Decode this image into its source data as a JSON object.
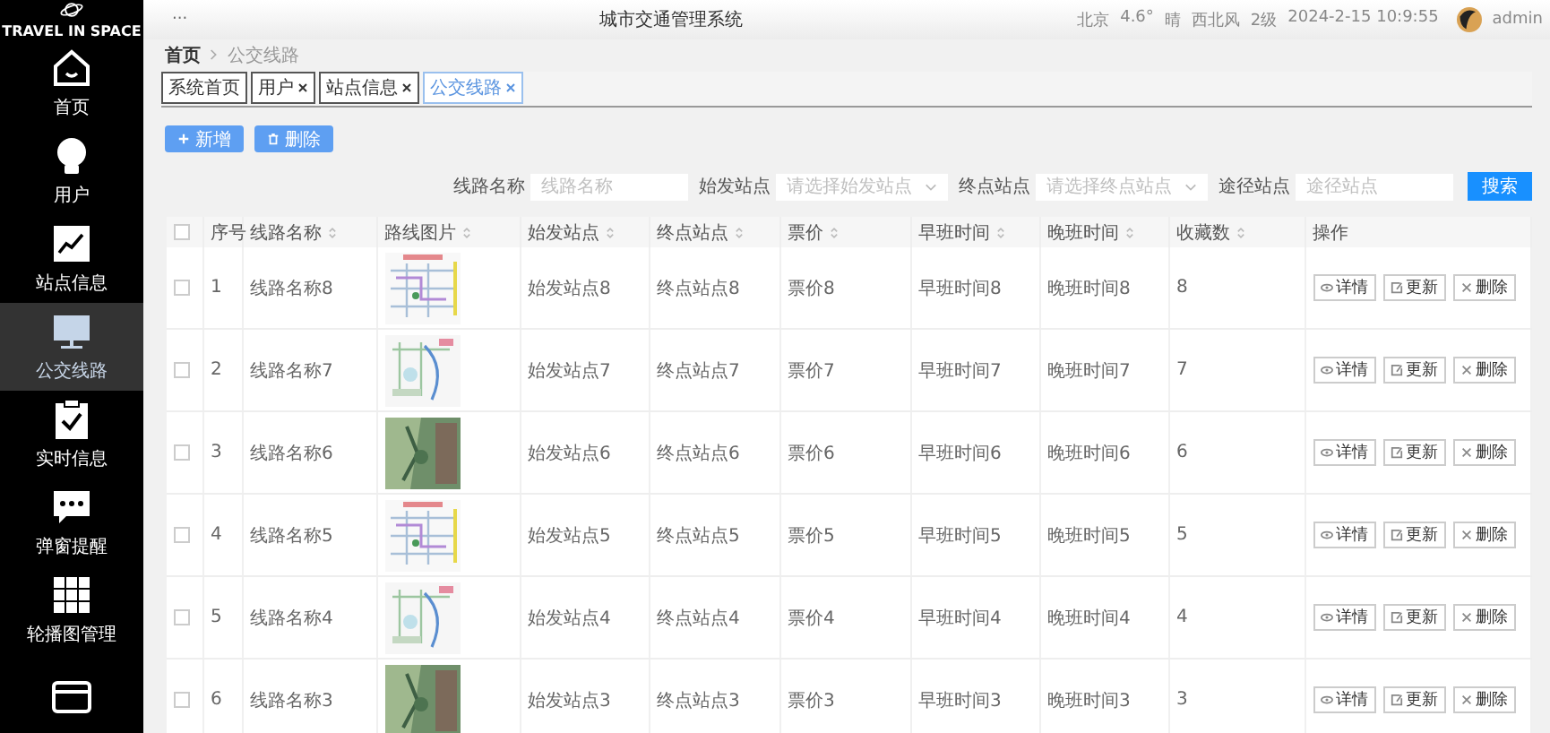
{
  "sidebar": {
    "logo": "TRAVEL IN SPACE",
    "items": [
      {
        "kind": "home",
        "label": "首页",
        "selected": false
      },
      {
        "kind": "bulb",
        "label": "用户",
        "selected": false
      },
      {
        "kind": "chart",
        "label": "站点信息",
        "selected": false
      },
      {
        "kind": "monitor",
        "label": "公交线路",
        "selected": true
      },
      {
        "kind": "clipboard",
        "label": "实时信息",
        "selected": false
      },
      {
        "kind": "chat",
        "label": "弹窗提醒",
        "selected": false
      },
      {
        "kind": "grid",
        "label": "轮播图管理",
        "selected": false
      },
      {
        "kind": "card",
        "selected": false
      }
    ]
  },
  "header": {
    "menu": "···",
    "title": "城市交通管理系统",
    "weather": [
      "北京",
      "4.6°",
      "晴",
      "西北风",
      "2级",
      "2024-2-15 10:9:55"
    ],
    "user": "admin"
  },
  "breadcrumb": [
    "首页",
    "公交线路"
  ],
  "tabs": [
    {
      "label": "系统首页",
      "closable": false,
      "selected": false
    },
    {
      "label": "用户",
      "closable": true,
      "selected": false
    },
    {
      "label": "站点信息",
      "closable": true,
      "selected": false
    },
    {
      "label": "公交线路",
      "closable": true,
      "selected": true
    }
  ],
  "actions": [
    {
      "kind": "add",
      "label": "新增"
    },
    {
      "kind": "delete",
      "label": "删除"
    }
  ],
  "search": {
    "fields": [
      {
        "label": "线路名称",
        "placeholder": "线路名称",
        "kind": "input"
      },
      {
        "label": "始发站点",
        "placeholder": "请选择始发站点",
        "kind": "select"
      },
      {
        "label": "终点站点",
        "placeholder": "请选择终点站点",
        "kind": "select"
      },
      {
        "label": "途径站点",
        "placeholder": "途径站点",
        "kind": "input"
      }
    ],
    "button": "搜索"
  },
  "table": {
    "select_all": {
      "checked": false
    },
    "columns": [
      {
        "label": "序号",
        "sortable": false
      },
      {
        "label": "线路名称",
        "sortable": true
      },
      {
        "label": "路线图片",
        "sortable": true
      },
      {
        "label": "始发站点",
        "sortable": true
      },
      {
        "label": "终点站点",
        "sortable": true
      },
      {
        "label": "票价",
        "sortable": true
      },
      {
        "label": "早班时间",
        "sortable": true
      },
      {
        "label": "晚班时间",
        "sortable": true
      },
      {
        "label": "收藏数",
        "sortable": true
      },
      {
        "label": "操作",
        "sortable": false
      }
    ],
    "rows": [
      {
        "checked": false,
        "index": "1",
        "name": "线路名称8",
        "start": "始发站点8",
        "end": "终点站点8",
        "fare": "票价8",
        "first": "早班时间8",
        "last": "晚班时间8",
        "favorites": "8",
        "actions": [
          {
            "kind": "view",
            "label": "详情"
          },
          {
            "kind": "edit",
            "label": "更新"
          },
          {
            "kind": "delete",
            "label": "删除"
          }
        ]
      },
      {
        "checked": false,
        "index": "2",
        "name": "线路名称7",
        "start": "始发站点7",
        "end": "终点站点7",
        "fare": "票价7",
        "first": "早班时间7",
        "last": "晚班时间7",
        "favorites": "7",
        "actions": [
          {
            "kind": "view",
            "label": "详情"
          },
          {
            "kind": "edit",
            "label": "更新"
          },
          {
            "kind": "delete",
            "label": "删除"
          }
        ]
      },
      {
        "checked": false,
        "index": "3",
        "name": "线路名称6",
        "start": "始发站点6",
        "end": "终点站点6",
        "fare": "票价6",
        "first": "早班时间6",
        "last": "晚班时间6",
        "favorites": "6",
        "actions": [
          {
            "kind": "view",
            "label": "详情"
          },
          {
            "kind": "edit",
            "label": "更新"
          },
          {
            "kind": "delete",
            "label": "删除"
          }
        ]
      },
      {
        "checked": false,
        "index": "4",
        "name": "线路名称5",
        "start": "始发站点5",
        "end": "终点站点5",
        "fare": "票价5",
        "first": "早班时间5",
        "last": "晚班时间5",
        "favorites": "5",
        "actions": [
          {
            "kind": "view",
            "label": "详情"
          },
          {
            "kind": "edit",
            "label": "更新"
          },
          {
            "kind": "delete",
            "label": "删除"
          }
        ]
      },
      {
        "checked": false,
        "index": "5",
        "name": "线路名称4",
        "start": "始发站点4",
        "end": "终点站点4",
        "fare": "票价4",
        "first": "早班时间4",
        "last": "晚班时间4",
        "favorites": "4",
        "actions": [
          {
            "kind": "view",
            "label": "详情"
          },
          {
            "kind": "edit",
            "label": "更新"
          },
          {
            "kind": "delete",
            "label": "删除"
          }
        ]
      },
      {
        "checked": false,
        "index": "6",
        "name": "线路名称3",
        "start": "始发站点3",
        "end": "终点站点3",
        "fare": "票价3",
        "first": "早班时间3",
        "last": "晚班时间3",
        "favorites": "3",
        "actions": [
          {
            "kind": "view",
            "label": "详情"
          },
          {
            "kind": "edit",
            "label": "更新"
          },
          {
            "kind": "delete",
            "label": "删除"
          }
        ]
      }
    ]
  }
}
